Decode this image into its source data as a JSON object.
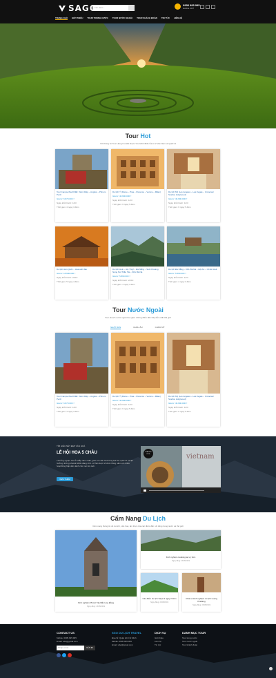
{
  "header": {
    "logo_text": "SAGO",
    "search_placeholder": "Tìm kiếm...",
    "hotline_number": "0995 995 995",
    "hotline_sub": "Hotline 24/7",
    "nav": [
      "TRANG CHỦ",
      "GIỚI THIỆU",
      "TOUR TRONG NƯỚC",
      "TOUR NƯỚC NGOÀI",
      "TOUR KHÁCH ĐOÀN",
      "TIN TỨC",
      "LIÊN HỆ"
    ]
  },
  "tour_hot": {
    "title_a": "Tour",
    "title_b": "Hot",
    "subtitle": "Với thông tin Tour Hàng Ưu Đãi Được Yêu Mới Nhất của từ 2 Việt Nam và Quốc tế",
    "cards": [
      {
        "name": "Tour Campuchia 4N3Đ: Xiêm Riệp – Angkor – Phnom Penh",
        "price": "Giá từ: 6.870.000 ₫",
        "meta1": "Ngày khởi hành: 12/3",
        "meta2": "Thời gian: 4 ngày 3 đêm"
      },
      {
        "name": "Du lịch Ý (Rome – Pisa – Florence – Venice – Milan)",
        "price": "Giá từ: 46.990.000 ₫",
        "meta1": "Ngày khởi hành: 12/3",
        "meta2": "Thời gian: 6 ngày 5 đêm"
      },
      {
        "name": "Du lịch Mỹ (Los Angeles – Las Vegas – Universal Studios Hollywood)",
        "price": "Giá từ: 46.990.000 ₫",
        "meta1": "Ngày khởi hành: 12/3",
        "meta2": "Thời gian: 6 ngày 5 đêm"
      },
      {
        "name": "Du lịch Hàn Quốc – Hoa anh đào",
        "price": "Giá từ: 18.990.000 ₫",
        "meta1": "Ngày khởi hành: 22/10",
        "meta2": "Thời gian: 5 ngày 4 đêm"
      },
      {
        "name": "Du lịch Huế – Hội Thuỷ – Đà Nẵng – Suối Khoáng Nóng Núi Thần Tài – KDL Bà Nà",
        "price": "Giá từ: 5.890.000 ₫",
        "meta1": "Ngày khởi hành: 22/10",
        "meta2": "Thời gian: 4 ngày 3 đêm"
      },
      {
        "name": "Du lịch Đà Nẵng – KDL Bà Nà – Hội An – Cổ Đô Huế",
        "price": "Giá từ: 5.590.000 ₫",
        "meta1": "Ngày khởi hành: 12/3",
        "meta2": "Thời gian: 4 ngày 3 đêm"
      }
    ]
  },
  "tour_foreign": {
    "title_a": "Tour",
    "title_b": "Nước Ngoài",
    "subtitle": "Tour du lịch nước ngoài bao gồm những điểm đến hấp dẫn nhất thế giới",
    "tabs": [
      "NHẬT BẢN",
      "CHÂU ÂU",
      "CHÂU MỸ"
    ],
    "cards": [
      {
        "name": "Tour Campuchia 4N3Đ: Xiêm Riệp – Angkor – Phnom Penh",
        "price": "Giá từ: 6.870.000 ₫",
        "meta1": "Ngày khởi hành: 12/3",
        "meta2": "Thời gian: 4 ngày 3 đêm"
      },
      {
        "name": "Du lịch Ý (Rome – Pisa – Florence – Venice – Milan)",
        "price": "Giá từ: 46.990.000 ₫",
        "meta1": "Ngày khởi hành: 12/3",
        "meta2": "Thời gian: 6 ngày 5 đêm"
      },
      {
        "name": "Du lịch Mỹ (Los Angeles – Las Vegas – Universal Studios Hollywood)",
        "price": "Giá từ: 46.990.000 ₫",
        "meta1": "Ngày khởi hành: 12/3",
        "meta2": "Thời gian: 6 ngày 5 đêm"
      }
    ]
  },
  "festival": {
    "label": "TÌM HIỂU NÉT ĐẸP VĂN HOÁ",
    "title": "LỄ HỘI HOA 5 CHÂU",
    "desc": "Thưởng ngoạn hoa ở khắp năm châu, giao lưu văn hoá cùng bạn bè quốc tế và tận hưởng những khoảnh khắc đáng nhớ. Lễ hội được tổ chức hằng năm với nhiều hoạt động hấp dẫn dành cho mọi lứa tuổi.",
    "button": "XEM THÊM",
    "video_text": "vietnam",
    "video_logo": "STARTUP PICK"
  },
  "guide": {
    "title_a": "Cẩm Nang",
    "title_b": "Du Lịch",
    "subtitle": "Cẩm nang thông tin về du lịch, văn hoá, ẩm thực của các điểm đến nổi tiếng trong nước và thế giới",
    "cards": [
      {
        "cap": "Kinh nghiệm Phượt Tây Bắc Hoa Đẳng",
        "date": "Ngày đăng: 23/05/2019"
      },
      {
        "cap": "Kinh nghiệm trekking tại Lý Sơn",
        "date": "Ngày đăng: 23/05/2019"
      },
      {
        "cap": "Các điểm du lịch Sapa 3 ngày 2 đêm",
        "date": "Ngày đăng: 23/05/2019"
      },
      {
        "cap": "Chia sẻ kinh nghiệm du lịch Luang Prabang",
        "date": "Ngày đăng: 23/05/2019"
      }
    ]
  },
  "footer": {
    "contact_title": "CONTACT US",
    "contact_lines": [
      "Mobile: 0995.995.995",
      "Email: abc@gmail.com"
    ],
    "email_placeholder": "Nhập email",
    "email_button": "GỬI ĐI",
    "travel_title": "SGO DU LỊCH TRAVEL",
    "travel_lines": [
      "Địa chỉ: Quận Hồ Chí Minh",
      "Mobile: 0995 995 995",
      "Email: abc@gmail.com"
    ],
    "service_title": "DỊCH VỤ",
    "service_lines": [
      "Giới thiệu",
      "Liên hệ",
      "Tin tức"
    ],
    "category_title": "DANH MỤC TOUR",
    "category_lines": [
      "Tour trong nước",
      "Tour nước ngoài",
      "Tour khách đoàn"
    ]
  }
}
